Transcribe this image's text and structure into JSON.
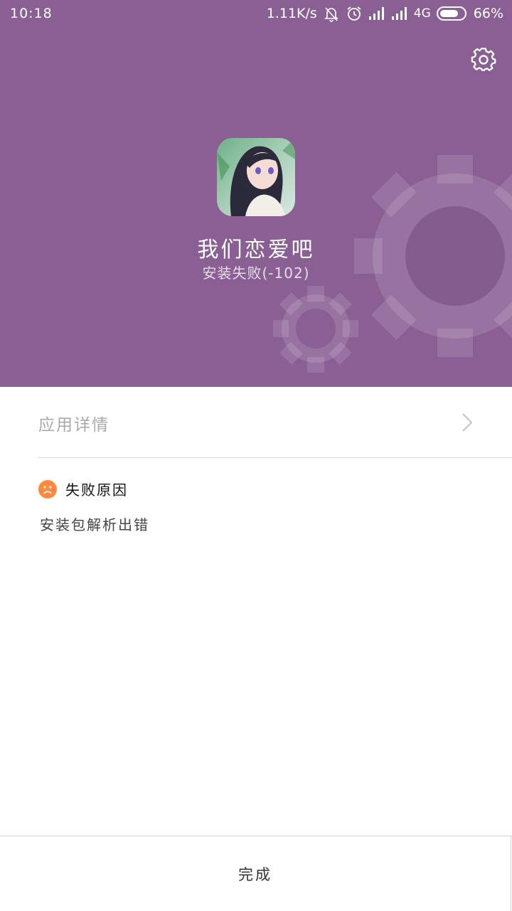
{
  "status_bar": {
    "time": "10:18",
    "net_speed": "1.11K/s",
    "network_type": "4G",
    "battery": "66%",
    "icons": [
      "bell-off-icon",
      "alarm-icon",
      "signal-icon",
      "signal-icon",
      "battery-icon"
    ]
  },
  "header": {
    "background_color": "#8a6094",
    "settings_icon": "gear-icon"
  },
  "app": {
    "name": "我们恋爱吧",
    "status": "安装失败(-102)"
  },
  "details": {
    "label": "应用详情",
    "chevron_icon": "chevron-right-icon"
  },
  "failure": {
    "title": "失败原因",
    "icon": "sad-face-icon",
    "icon_color": "#ff8a3d",
    "reason": "安装包解析出错"
  },
  "footer": {
    "done_label": "完成"
  }
}
